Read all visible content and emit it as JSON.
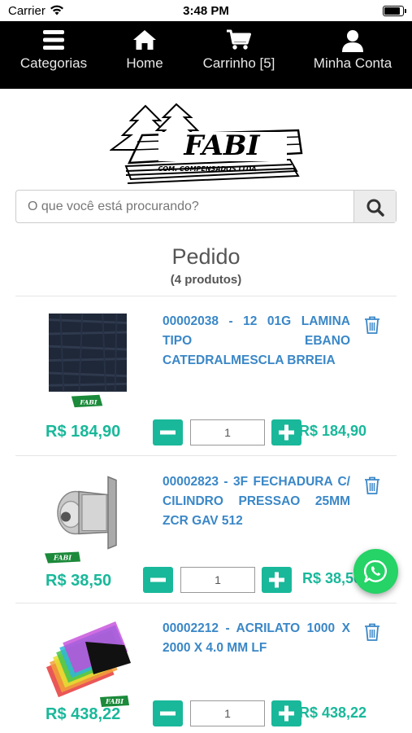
{
  "status_bar": {
    "carrier": "Carrier",
    "time": "3:48 PM",
    "battery_level": 0.9
  },
  "nav": {
    "categories": {
      "label": "Categorias",
      "icon": "hamburger-icon"
    },
    "home": {
      "label": "Home",
      "icon": "home-icon"
    },
    "cart": {
      "label": "Carrinho [5]",
      "icon": "cart-icon"
    },
    "account": {
      "label": "Minha Conta",
      "icon": "user-icon"
    }
  },
  "logo": {
    "brand": "FABI",
    "tagline": "COM. COMPENSADOS LTDA"
  },
  "search": {
    "placeholder": "O que você está procurando?",
    "button_icon": "search-icon"
  },
  "order": {
    "title": "Pedido",
    "count": "(4 produtos)"
  },
  "products": [
    {
      "desc": "00002038 - 12 01G LAMINA TIPO EBANO CATEDRALMESCLA BRREIA",
      "price": "R$ 184,90",
      "qty": "1",
      "total": "R$ 184,90"
    },
    {
      "desc": "00002823 - 3F FECHADURA C/ CILINDRO PRESSAO 25MM ZCR GAV 512",
      "price": "R$ 38,50",
      "qty": "1",
      "total": "R$ 38,50"
    },
    {
      "desc": "00002212 - ACRILATO 1000 X 2000 X 4.0 MM LF",
      "price": "R$ 438,22",
      "qty": "1",
      "total": "R$ 438,22"
    }
  ],
  "colors": {
    "accent": "#19b89a",
    "link": "#3a87c7",
    "nav_bg": "#000000",
    "whatsapp": "#25d366"
  },
  "floating": {
    "icon": "whatsapp-icon"
  }
}
